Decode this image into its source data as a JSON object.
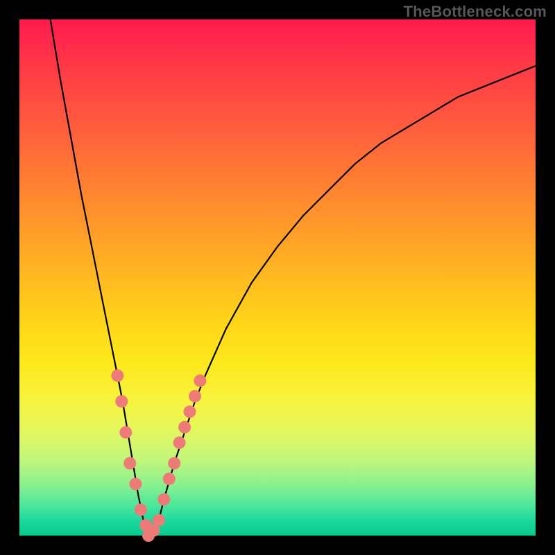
{
  "watermark": "TheBottleneck.com",
  "chart_data": {
    "type": "line",
    "title": "",
    "xlabel": "",
    "ylabel": "",
    "xlim": [
      0,
      100
    ],
    "ylim": [
      0,
      100
    ],
    "grid": false,
    "legend": false,
    "series": [
      {
        "name": "curve",
        "color": "#000000",
        "x": [
          6,
          8,
          10,
          12,
          14,
          16,
          18,
          19,
          20,
          21,
          22,
          23,
          24,
          25,
          26,
          27,
          28,
          30,
          32,
          34,
          36,
          40,
          45,
          50,
          55,
          60,
          65,
          70,
          75,
          80,
          85,
          90,
          95,
          100
        ],
        "y": [
          100,
          88,
          77,
          66,
          56,
          46,
          36,
          31,
          26,
          20,
          14,
          8,
          3,
          0,
          0,
          3,
          7,
          14,
          20,
          26,
          31,
          40,
          49,
          56,
          62,
          67,
          72,
          76,
          79,
          82,
          85,
          87,
          89,
          91
        ]
      },
      {
        "name": "markers",
        "color": "#ef7b78",
        "type": "scatter",
        "points": [
          {
            "x": 19.0,
            "y": 31
          },
          {
            "x": 19.8,
            "y": 26
          },
          {
            "x": 20.6,
            "y": 20
          },
          {
            "x": 21.4,
            "y": 14
          },
          {
            "x": 22.5,
            "y": 10
          },
          {
            "x": 23.5,
            "y": 5
          },
          {
            "x": 24.5,
            "y": 2
          },
          {
            "x": 25.0,
            "y": 0
          },
          {
            "x": 26.0,
            "y": 1
          },
          {
            "x": 27.0,
            "y": 3
          },
          {
            "x": 28.0,
            "y": 7
          },
          {
            "x": 29.0,
            "y": 11
          },
          {
            "x": 30.0,
            "y": 14
          },
          {
            "x": 31.0,
            "y": 18
          },
          {
            "x": 32.0,
            "y": 21
          },
          {
            "x": 33.0,
            "y": 24
          },
          {
            "x": 34.0,
            "y": 27
          },
          {
            "x": 35.0,
            "y": 30
          }
        ]
      }
    ]
  },
  "colors": {
    "curve": "#000000",
    "marker": "#ef7b78",
    "frame": "#000000"
  }
}
